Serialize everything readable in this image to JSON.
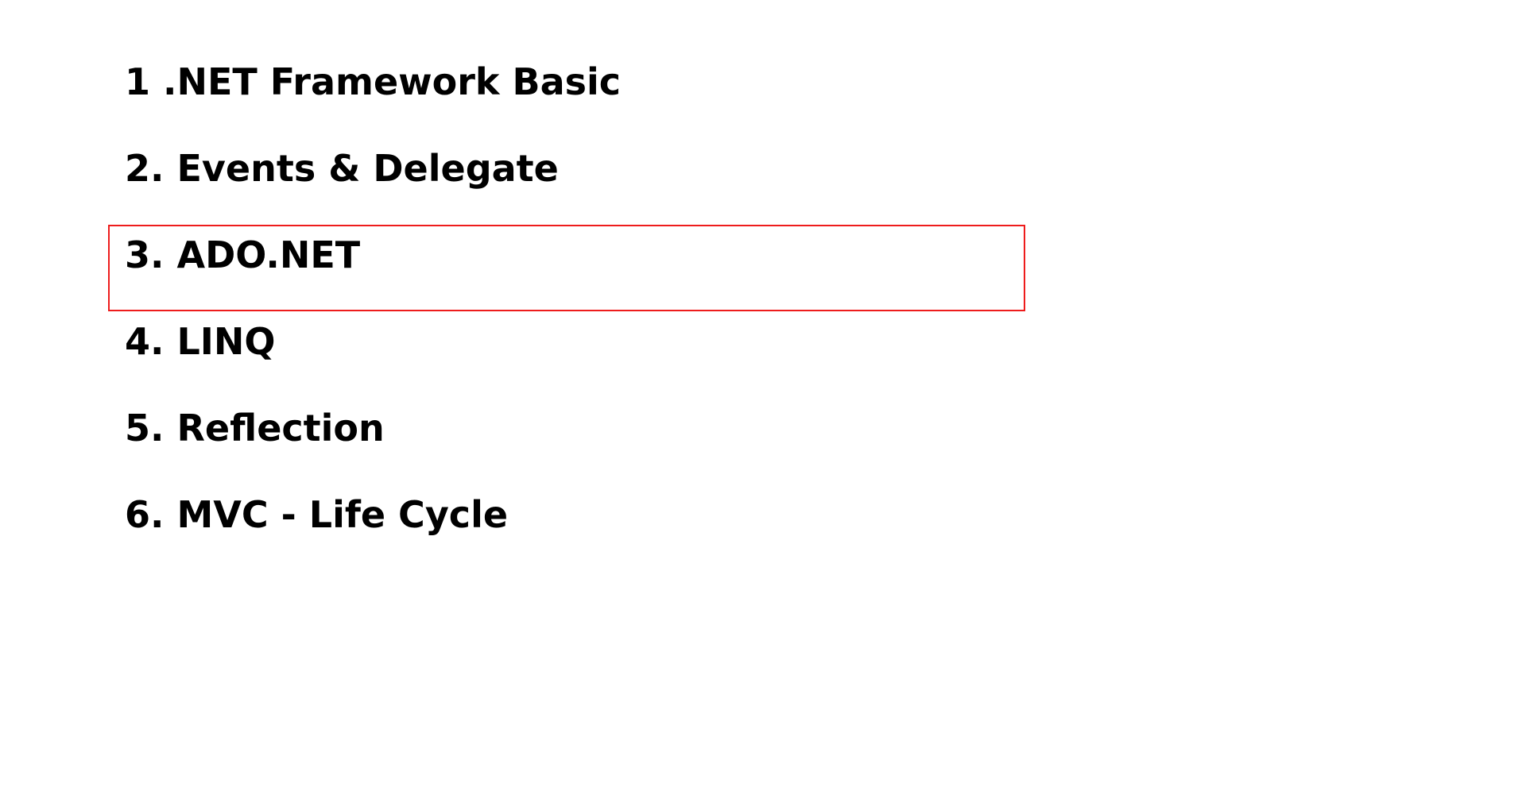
{
  "topics": [
    {
      "label": "1 .NET Framework Basic",
      "selected": false
    },
    {
      "label": "2. Events & Delegate",
      "selected": false
    },
    {
      "label": "3. ADO.NET",
      "selected": true
    },
    {
      "label": "4. LINQ",
      "selected": false
    },
    {
      "label": "5. Reflection",
      "selected": false
    },
    {
      "label": "6. MVC - Life Cycle",
      "selected": false
    }
  ],
  "colors": {
    "selection_border": "#ee1c1c",
    "text": "#000000",
    "background": "#ffffff"
  }
}
